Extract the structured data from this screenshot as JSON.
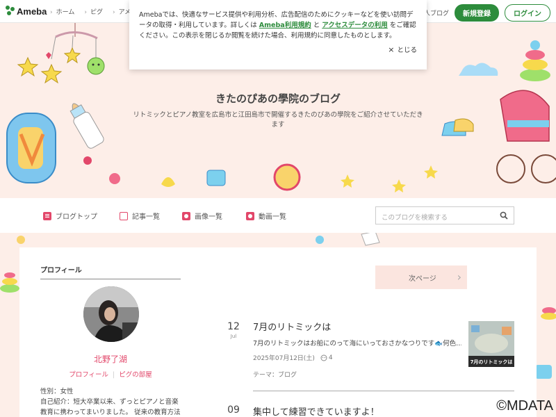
{
  "header": {
    "logo_text": "Ameba",
    "nav": [
      "ホーム",
      "ピグ",
      "アメブロ"
    ],
    "right_link": "芸能人ブログ",
    "register_label": "新規登録",
    "login_label": "ログイン"
  },
  "cookie_notice": {
    "text_before": "Amebaでは、快適なサービス提供や利用分析、広告配信のためにクッキーなどを使い訪問データの取得・利用しています。詳しくは ",
    "link1": "Ameba利用規約",
    "text_mid": " と ",
    "link2": "アクセスデータの利用",
    "text_after": " をご確認ください。この表示を閉じるか閲覧を続けた場合、利用規約に同意したものとします。",
    "close_label": "とじる"
  },
  "blog": {
    "title": "きたのぴあの學院のブログ",
    "description": "リトミックとピアノ教室を広島市と江田島市で開催するきたのぴあの學院をご紹介させていただきます"
  },
  "blog_nav": {
    "items": [
      "ブログトップ",
      "記事一覧",
      "画像一覧",
      "動画一覧"
    ],
    "search_placeholder": "このブログを検索する"
  },
  "profile": {
    "heading": "プロフィール",
    "name": "北野了湖",
    "link_profile": "プロフィール",
    "link_room": "ピグの部屋",
    "gender": "性別：女性",
    "intro": "自己紹介：短大卒業以来、ずっとピアノと音楽教育に携わってまいりました。 従来の教育方法"
  },
  "pager": {
    "next_label": "次ページ"
  },
  "entries": [
    {
      "day": "12",
      "month": "Jul",
      "title": "7月のリトミックは",
      "excerpt": "7月のリトミックはお船にのって海にいっておさかなつりです🐟何色…",
      "date": "2025年07月12日(土)",
      "comments": "4",
      "theme": "テーマ：ブログ",
      "thumb_caption": "7月のリトミックは"
    },
    {
      "day": "09",
      "month": "",
      "title": "集中して練習できていますよ！"
    }
  ],
  "watermark": "©MDATA",
  "colors": {
    "brand_green": "#2d8c3c",
    "accent_pink": "#e2476a",
    "hero_bg": "#fdeee8"
  }
}
